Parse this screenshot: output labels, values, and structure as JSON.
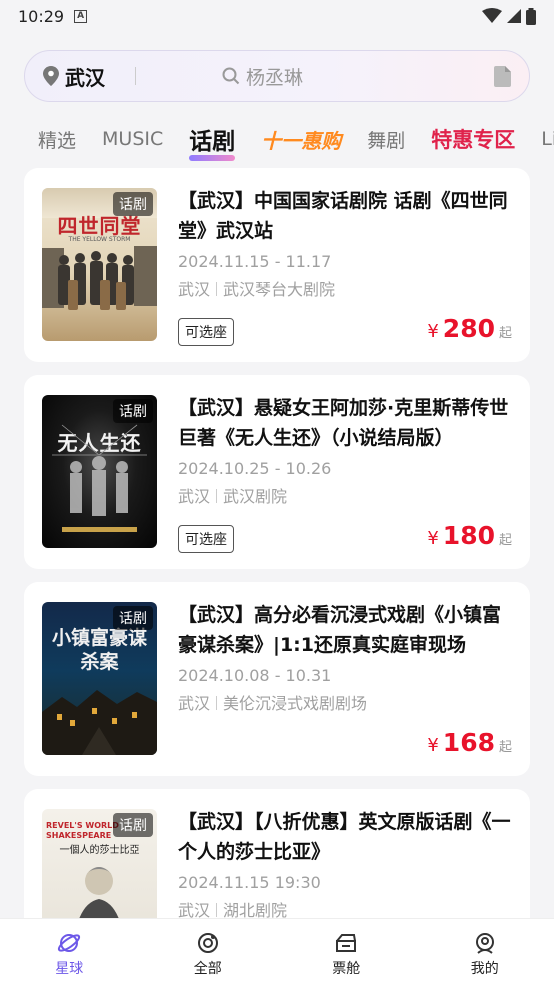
{
  "status_bar": {
    "time": "10:29",
    "badge": "A"
  },
  "search": {
    "city": "武汉",
    "query": "杨丞琳"
  },
  "tabs": [
    {
      "label": "精选"
    },
    {
      "label": "MUSIC"
    },
    {
      "label": "话剧",
      "active": true
    },
    {
      "label": "十一惠购"
    },
    {
      "label": "舞剧"
    },
    {
      "label": "特惠专区"
    },
    {
      "label": "Li"
    }
  ],
  "events": [
    {
      "tag": "话剧",
      "poster_text": "四世同堂",
      "poster_sub": "THE YELLOW STORM",
      "title": "【武汉】中国国家话剧院 话剧《四世同堂》武汉站",
      "date": "2024.11.15 - 11.17",
      "city": "武汉",
      "venue": "武汉琴台大剧院",
      "seat_label": "可选座",
      "currency": "¥",
      "price": "280",
      "price_suffix": "起"
    },
    {
      "tag": "话剧",
      "poster_text": "无人生还",
      "poster_sub": "",
      "title": "【武汉】悬疑女王阿加莎·克里斯蒂传世巨著《无人生还》（小说结局版）",
      "date": "2024.10.25 - 10.26",
      "city": "武汉",
      "venue": "武汉剧院",
      "seat_label": "可选座",
      "currency": "¥",
      "price": "180",
      "price_suffix": "起"
    },
    {
      "tag": "话剧",
      "poster_text": "小镇富豪谋杀案",
      "poster_sub": "",
      "title": "【武汉】高分必看沉浸式戏剧《小镇富豪谋杀案》|1:1还原真实庭审现场",
      "date": "2024.10.08 - 10.31",
      "city": "武汉",
      "venue": "美伦沉浸式戏剧剧场",
      "seat_label": "",
      "currency": "¥",
      "price": "168",
      "price_suffix": "起"
    },
    {
      "tag": "话剧",
      "poster_text": "一個人的莎士比亞",
      "poster_sub": "REVEL'S WORLD SHAKESPEARE",
      "title": "【武汉】【八折优惠】英文原版话剧《一个人的莎士比亚》",
      "date": "2024.11.15 19:30",
      "city": "武汉",
      "venue": "湖北剧院",
      "seat_label": "",
      "currency": "",
      "price": "",
      "price_suffix": ""
    }
  ],
  "bottom_nav": [
    {
      "label": "星球",
      "icon": "planet-icon",
      "active": true
    },
    {
      "label": "全部",
      "icon": "all-icon"
    },
    {
      "label": "票舱",
      "icon": "ticket-cabin-icon"
    },
    {
      "label": "我的",
      "icon": "profile-icon"
    }
  ],
  "colors": {
    "accent": "#6d58e8",
    "price": "#e8132b",
    "promo_orange": "#ff8a1f",
    "promo_red": "#e0224b"
  }
}
